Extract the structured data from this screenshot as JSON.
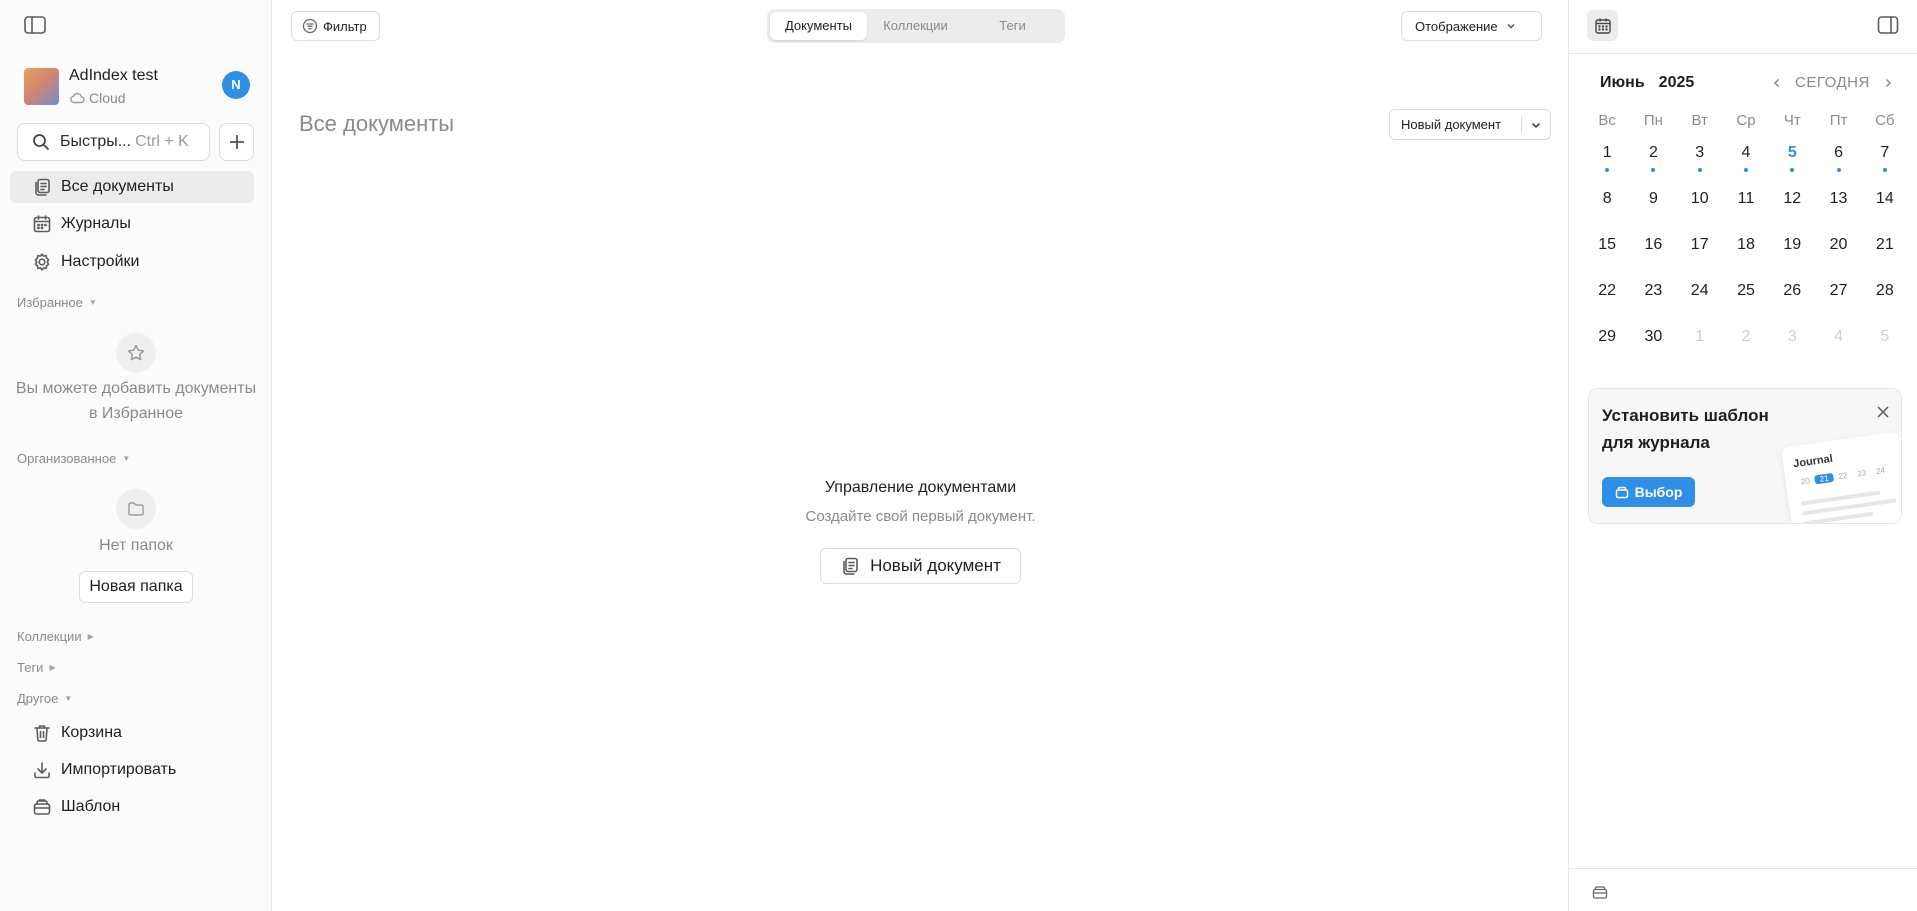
{
  "sidebar": {
    "workspace_name": "AdIndex test",
    "workspace_type": "Cloud",
    "user_initial": "N",
    "search_label": "Быстры...",
    "search_shortcut": "Ctrl + K",
    "nav": [
      {
        "label": "Все документы",
        "icon": "documents-icon"
      },
      {
        "label": "Журналы",
        "icon": "calendar-icon"
      },
      {
        "label": "Настройки",
        "icon": "gear-icon"
      }
    ],
    "favorites": {
      "title": "Избранное",
      "empty_text": "Вы можете добавить документы в Избранное"
    },
    "organized": {
      "title": "Организованное",
      "empty_text": "Нет папок",
      "new_folder": "Новая папка"
    },
    "collections_title": "Коллекции",
    "tags_title": "Теги",
    "other": {
      "title": "Другое",
      "items": [
        {
          "label": "Корзина",
          "icon": "trash-icon"
        },
        {
          "label": "Импортировать",
          "icon": "download-icon"
        },
        {
          "label": "Шаблон",
          "icon": "template-icon"
        }
      ]
    }
  },
  "main": {
    "filter_label": "Фильтр",
    "tabs": [
      {
        "label": "Документы",
        "active": true
      },
      {
        "label": "Коллекции",
        "active": false
      },
      {
        "label": "Теги",
        "active": false
      }
    ],
    "view_label": "Отображение",
    "page_title": "Все документы",
    "new_doc_split_label": "Новый документ",
    "empty_title": "Управление документами",
    "empty_subtitle": "Создайте свой первый документ.",
    "new_doc_button": "Новый документ"
  },
  "calendar": {
    "month": "Июнь",
    "year": "2025",
    "today_label": "СЕГОДНЯ",
    "weekdays": [
      "Вс",
      "Пн",
      "Вт",
      "Ср",
      "Чт",
      "Пт",
      "Сб"
    ],
    "weeks": [
      [
        "1",
        "2",
        "3",
        "4",
        "5",
        "6",
        "7"
      ],
      [
        "8",
        "9",
        "10",
        "11",
        "12",
        "13",
        "14"
      ],
      [
        "15",
        "16",
        "17",
        "18",
        "19",
        "20",
        "21"
      ],
      [
        "22",
        "23",
        "24",
        "25",
        "26",
        "27",
        "28"
      ],
      [
        "29",
        "30",
        "1",
        "2",
        "3",
        "4",
        "5"
      ]
    ],
    "today": "5",
    "dotted_days": [
      "1",
      "2",
      "3",
      "4",
      "5",
      "6",
      "7"
    ],
    "accent_color": "#2f8ee5"
  },
  "promo": {
    "title": "Установить шаблон для журнала",
    "button": "Выбор",
    "card_title": "Journal",
    "card_days": [
      "20",
      "21",
      "22",
      "23",
      "24"
    ],
    "card_highlight": "21"
  }
}
